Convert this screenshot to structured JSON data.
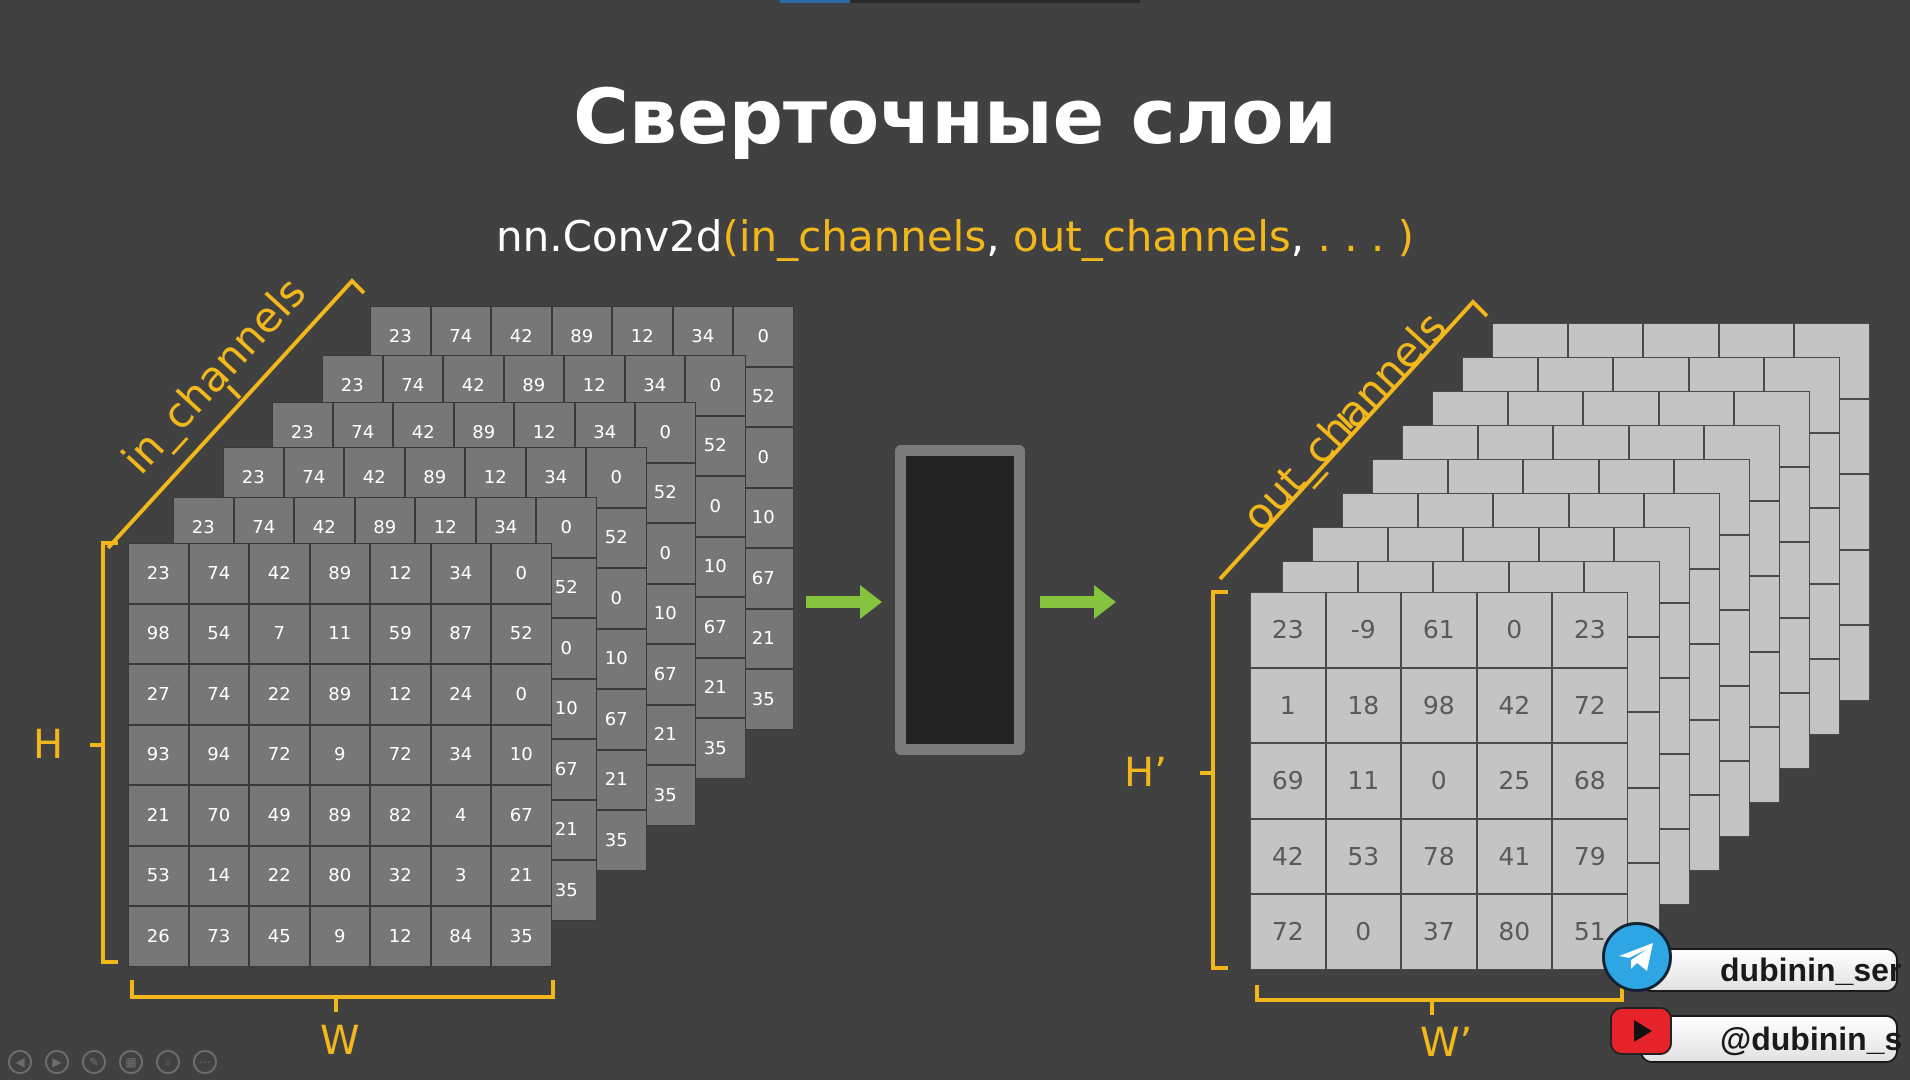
{
  "title": "Сверточные слои",
  "call": {
    "prefix": "nn.Conv2d",
    "open": "(",
    "arg1": "in_channels",
    "sep1": ", ",
    "arg2": "out_channels",
    "sep2": ", ",
    "rest": ". . . )"
  },
  "labels": {
    "in_channels": "in_channels",
    "out_channels": "out_channels",
    "H": "H",
    "W": "W",
    "H_out": "H’",
    "W_out": "W’"
  },
  "input_back_row": [
    "23",
    "74",
    "42",
    "89",
    "12",
    "34",
    "0"
  ],
  "input_right_col": [
    "0",
    "52",
    "0",
    "10",
    "67",
    "21",
    "35"
  ],
  "input_grid": [
    [
      "23",
      "74",
      "42",
      "89",
      "12",
      "34",
      "0"
    ],
    [
      "98",
      "54",
      "7",
      "11",
      "59",
      "87",
      "52"
    ],
    [
      "27",
      "74",
      "22",
      "89",
      "12",
      "24",
      "0"
    ],
    [
      "93",
      "94",
      "72",
      "9",
      "72",
      "34",
      "10"
    ],
    [
      "21",
      "70",
      "49",
      "89",
      "82",
      "4",
      "67"
    ],
    [
      "53",
      "14",
      "22",
      "80",
      "32",
      "3",
      "21"
    ],
    [
      "26",
      "73",
      "45",
      "9",
      "12",
      "84",
      "35"
    ]
  ],
  "output_grid": [
    [
      "23",
      "-9",
      "61",
      "0",
      "23"
    ],
    [
      "1",
      "18",
      "98",
      "42",
      "72"
    ],
    [
      "69",
      "11",
      "0",
      "25",
      "68"
    ],
    [
      "42",
      "53",
      "78",
      "41",
      "79"
    ],
    [
      "72",
      "0",
      "37",
      "80",
      "51"
    ]
  ],
  "social": {
    "telegram": "dubinin_ser",
    "youtube": "@dubinin_s"
  },
  "colors": {
    "background": "#414141",
    "accent": "#f2b81b",
    "arrow": "#86c440",
    "input_cell": "#777777",
    "output_cell": "#c4c4c4"
  },
  "icons": [
    "telegram-icon",
    "youtube-icon",
    "arrow-right-icon"
  ]
}
